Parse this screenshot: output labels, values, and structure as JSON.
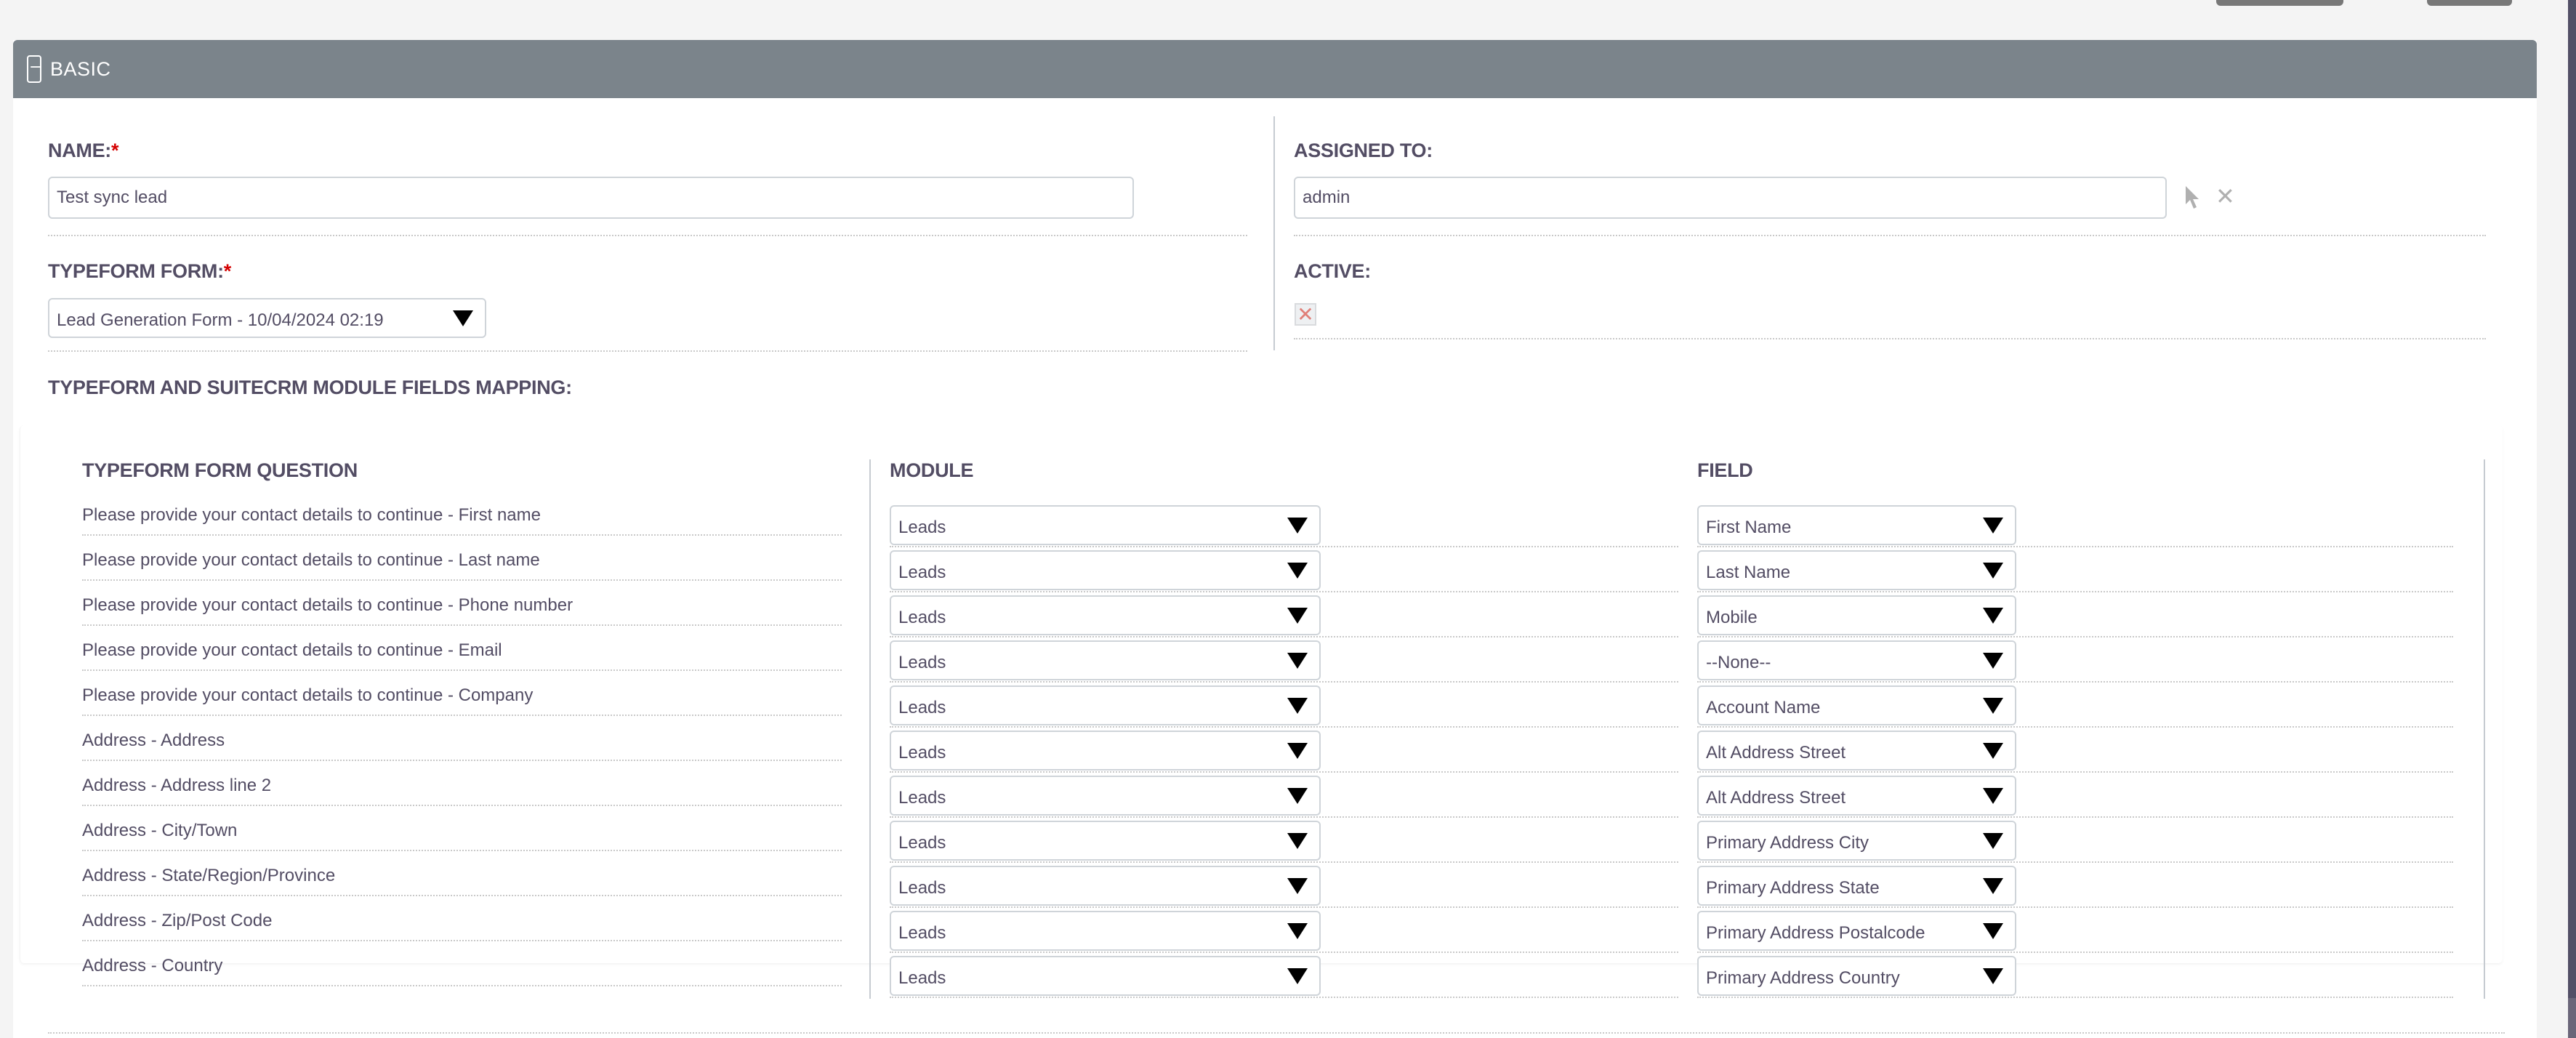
{
  "top_buttons": [
    {
      "name": "top-action-button-1",
      "label": ""
    },
    {
      "name": "top-action-button-2",
      "label": ""
    }
  ],
  "panel": {
    "title": "BASIC",
    "collapse_symbol": "−"
  },
  "fields": {
    "name": {
      "label": "NAME:",
      "required_mark": "*",
      "value": "Test sync lead"
    },
    "assigned_to": {
      "label": "ASSIGNED TO:",
      "value": "admin",
      "select_icon": "cursor-arrow-icon",
      "clear_icon": "close-icon",
      "clear_symbol": "✕"
    },
    "typeform_form": {
      "label": "TYPEFORM FORM:",
      "required_mark": "*",
      "value": "Lead Generation Form - 10/04/2024 02:19"
    },
    "active": {
      "label": "ACTIVE:",
      "checked": false,
      "symbol": "✕"
    }
  },
  "mapping": {
    "label": "TYPEFORM AND SUITECRM MODULE FIELDS MAPPING:",
    "columns": [
      "TYPEFORM FORM QUESTION",
      "MODULE",
      "FIELD"
    ],
    "rows": [
      {
        "question": "Please provide your contact details to continue - First name",
        "module": "Leads",
        "field": "First Name"
      },
      {
        "question": "Please provide your contact details to continue - Last name",
        "module": "Leads",
        "field": "Last Name"
      },
      {
        "question": "Please provide your contact details to continue - Phone number",
        "module": "Leads",
        "field": "Mobile"
      },
      {
        "question": "Please provide your contact details to continue - Email",
        "module": "Leads",
        "field": "--None--"
      },
      {
        "question": "Please provide your contact details to continue - Company",
        "module": "Leads",
        "field": "Account Name"
      },
      {
        "question": "Address - Address",
        "module": "Leads",
        "field": "Alt Address Street"
      },
      {
        "question": "Address - Address line 2",
        "module": "Leads",
        "field": "Alt Address Street"
      },
      {
        "question": "Address - City/Town",
        "module": "Leads",
        "field": "Primary Address City"
      },
      {
        "question": "Address - State/Region/Province",
        "module": "Leads",
        "field": "Primary Address State"
      },
      {
        "question": "Address - Zip/Post Code",
        "module": "Leads",
        "field": "Primary Address Postalcode"
      },
      {
        "question": "Address - Country",
        "module": "Leads",
        "field": "Primary Address Country"
      }
    ]
  },
  "colors": {
    "panel_header": "#7b848b",
    "text": "#534d64",
    "required": "#d40000",
    "scrollbar": "#524f66"
  }
}
